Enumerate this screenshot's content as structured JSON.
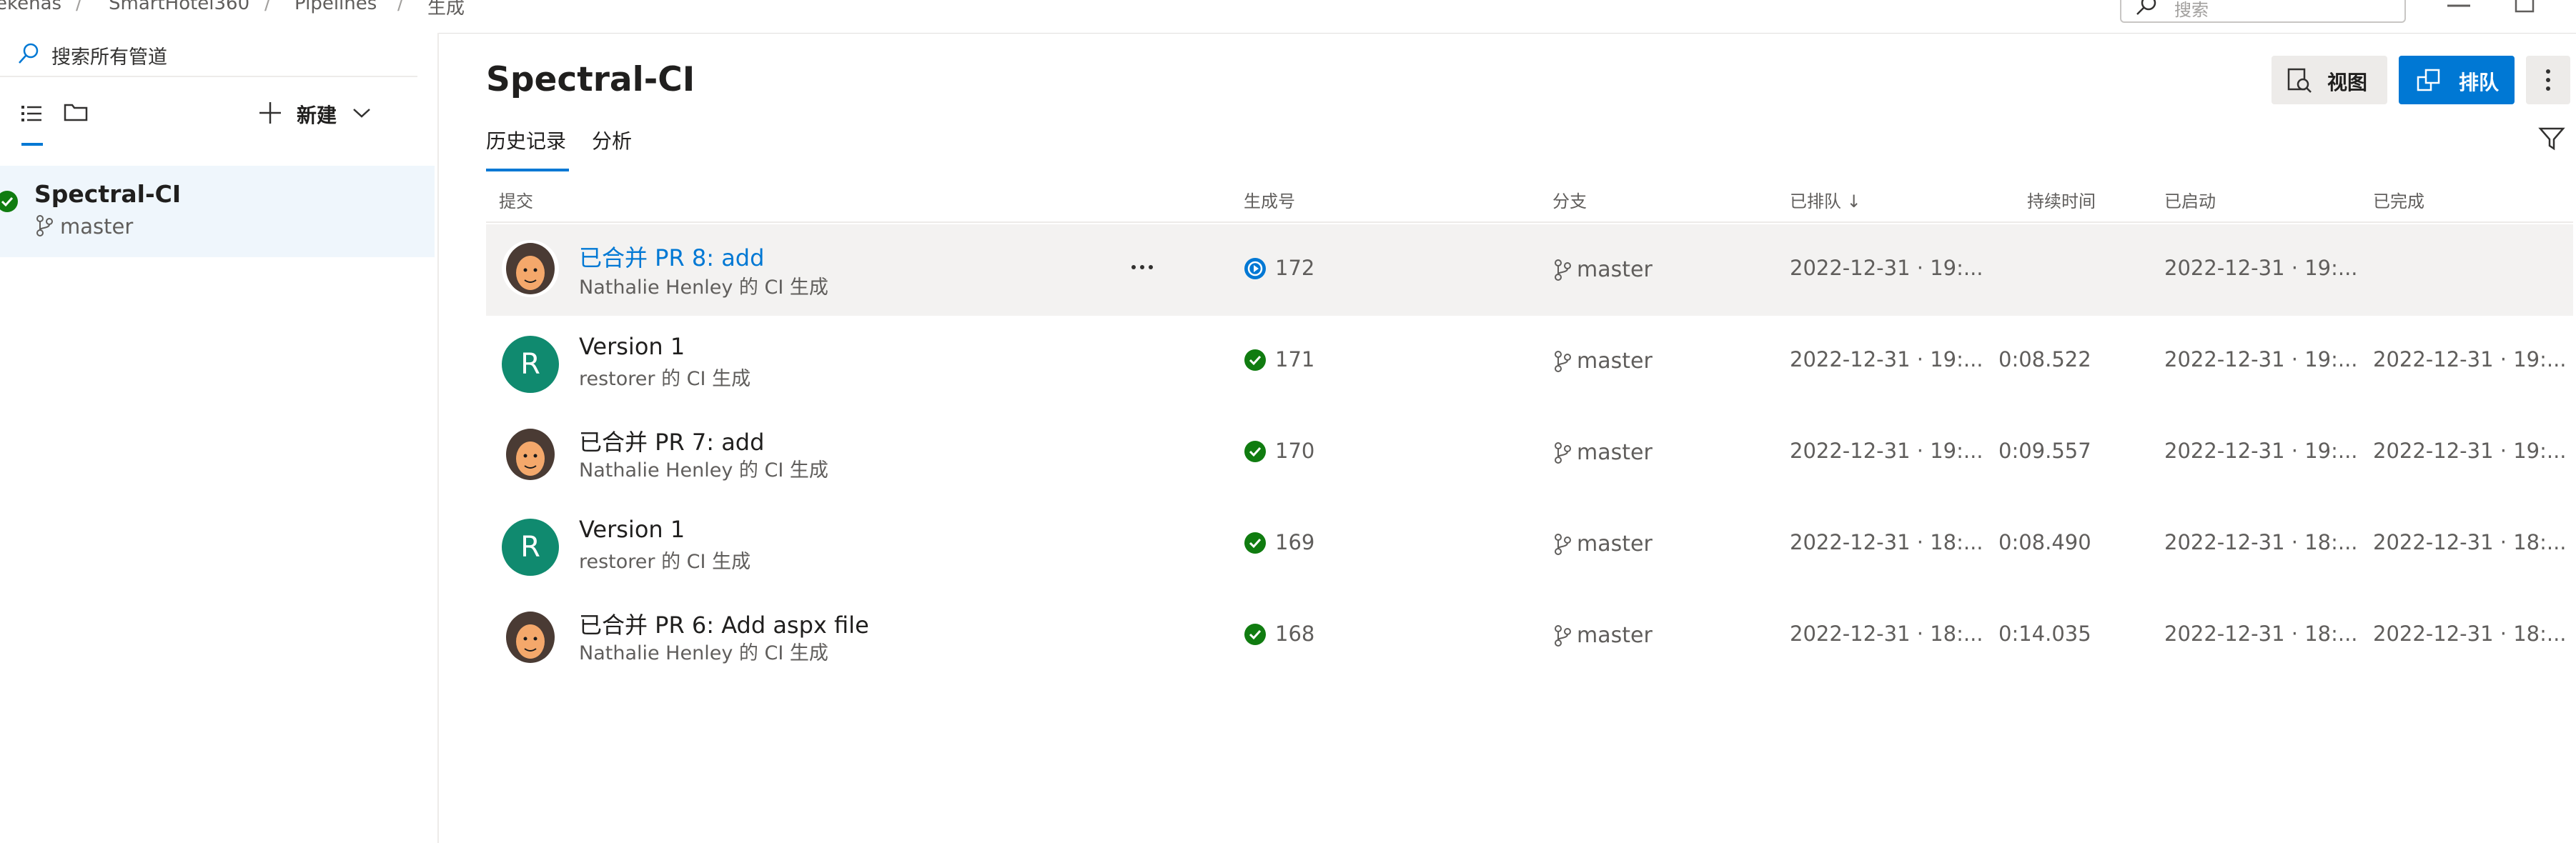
{
  "breadcrumb": [
    "ekenas",
    "SmartHotel360",
    "Pipelines",
    "生成"
  ],
  "top_search": {
    "placeholder": "搜索"
  },
  "sidebar": {
    "search_placeholder": "搜索所有管道",
    "new_label": "新建",
    "pipelines": [
      {
        "name": "Spectral-CI",
        "branch": "master",
        "status": "succeeded"
      }
    ]
  },
  "header": {
    "title": "Spectral-CI",
    "view_label": "视图",
    "queue_label": "排队",
    "tabs": [
      "历史记录",
      "分析"
    ]
  },
  "table": {
    "columns": [
      "提交",
      "生成号",
      "分支",
      "已排队 ↓",
      "持续时间",
      "已启动",
      "已完成"
    ],
    "rows": [
      {
        "title": "已合并 PR 8: add",
        "subtitle": "Nathalie Henley 的 CI 生成",
        "avatar": "face",
        "build": "172",
        "status": "running",
        "branch": "master",
        "queued": "2022-12-31 · 19:...",
        "duration": "",
        "started": "2022-12-31 · 19:...",
        "finished": ""
      },
      {
        "title": "Version 1",
        "subtitle": "restorer 的 CI 生成",
        "avatar": "R",
        "build": "171",
        "status": "succeeded",
        "branch": "master",
        "queued": "2022-12-31 · 19:...",
        "duration": "0:08.522",
        "started": "2022-12-31 · 19:...",
        "finished": "2022-12-31 · 19:..."
      },
      {
        "title": "已合并 PR 7: add",
        "subtitle": "Nathalie Henley 的 CI 生成",
        "avatar": "face",
        "build": "170",
        "status": "succeeded",
        "branch": "master",
        "queued": "2022-12-31 · 19:...",
        "duration": "0:09.557",
        "started": "2022-12-31 · 19:...",
        "finished": "2022-12-31 · 19:..."
      },
      {
        "title": "Version 1",
        "subtitle": "restorer 的 CI 生成",
        "avatar": "R",
        "build": "169",
        "status": "succeeded",
        "branch": "master",
        "queued": "2022-12-31 · 18:...",
        "duration": "0:08.490",
        "started": "2022-12-31 · 18:...",
        "finished": "2022-12-31 · 18:..."
      },
      {
        "title": "已合并 PR 6: Add aspx file",
        "subtitle": "Nathalie Henley 的 CI 生成",
        "avatar": "face",
        "build": "168",
        "status": "succeeded",
        "branch": "master",
        "queued": "2022-12-31 · 18:...",
        "duration": "0:14.035",
        "started": "2022-12-31 · 18:...",
        "finished": "2022-12-31 · 18:..."
      }
    ]
  },
  "colors": {
    "accent": "#0078d4",
    "success": "#107c10",
    "avatar_r": "#108a6f"
  }
}
